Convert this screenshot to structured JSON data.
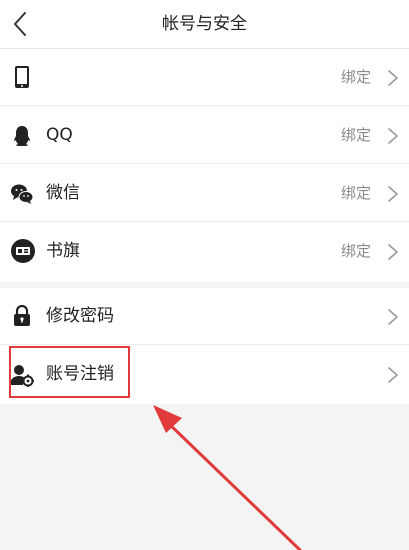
{
  "header": {
    "title": "帐号与安全"
  },
  "bindings": {
    "items": [
      {
        "label": "",
        "status": "绑定",
        "icon": "phone-icon"
      },
      {
        "label": "QQ",
        "status": "绑定",
        "icon": "qq-icon"
      },
      {
        "label": "微信",
        "status": "绑定",
        "icon": "wechat-icon"
      },
      {
        "label": "书旗",
        "status": "绑定",
        "icon": "shuqi-icon"
      }
    ]
  },
  "security": {
    "items": [
      {
        "label": "修改密码",
        "icon": "lock-icon"
      },
      {
        "label": "账号注销",
        "icon": "user-gear-icon"
      }
    ]
  },
  "annotation": {
    "highlight_color": "#e03a3a"
  }
}
